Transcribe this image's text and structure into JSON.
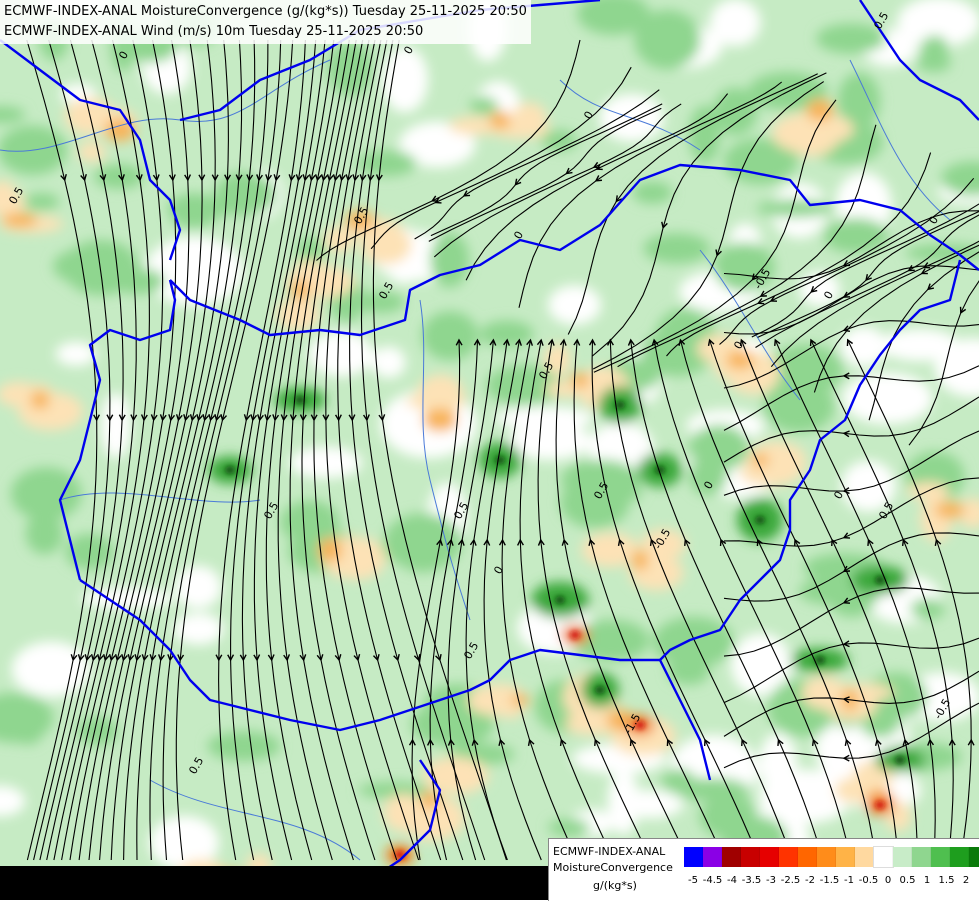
{
  "titles": {
    "line1": "ECMWF-INDEX-ANAL MoistureConvergence (g/(kg*s)) Tuesday 25-11-2025 20:50",
    "line2": "ECMWF-INDEX-ANAL Wind (m/s) 10m Tuesday 25-11-2025 20:50"
  },
  "legend": {
    "model": "ECMWF-INDEX-ANAL",
    "parameter": "MoistureConvergence",
    "unit": "g/(kg*s)",
    "ticks": [
      "-5",
      "-4.5",
      "-4",
      "-3.5",
      "-3",
      "-2.5",
      "-2",
      "-1.5",
      "-1",
      "-0.5",
      "0",
      "0.5",
      "1",
      "1.5",
      "2"
    ],
    "colors": [
      "#0000ff",
      "#8a00e6",
      "#a00000",
      "#c80000",
      "#e60000",
      "#ff3300",
      "#ff6600",
      "#ff8c1a",
      "#ffb347",
      "#ffd9a0",
      "#ffffff",
      "#c8ecc8",
      "#8fd68f",
      "#4fbf4f",
      "#1e9e1e",
      "#0a7a0a"
    ]
  },
  "contour_labels": [
    "0.5",
    "0",
    "0.5",
    "0",
    "0.5",
    "-0.5",
    "0.5",
    "0",
    "0.5",
    "0",
    "-0.5",
    "0.5",
    "-1.5",
    "0",
    "0.5",
    "0",
    "0.5",
    "0",
    "0.5",
    "0",
    "0.5",
    "-0.5",
    "0",
    "0",
    "0.5"
  ],
  "colors": {
    "border": "#0000ee",
    "river": "#4a7ad8",
    "streamline": "#000000",
    "green_light": "#c6ebc4",
    "green_mid": "#8fd68f",
    "green_dark": "#3aa83a",
    "orange_light": "#fde2b6",
    "orange_mid": "#f8b45a",
    "orange_dark": "#ef7a12"
  }
}
